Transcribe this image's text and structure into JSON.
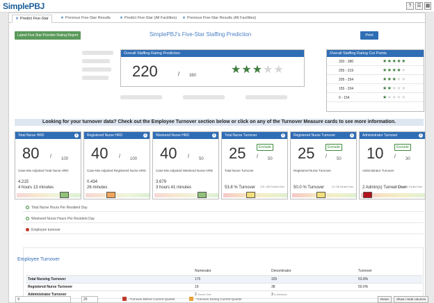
{
  "app": {
    "logo_main": "Simple",
    "logo_pbj": "PBJ",
    "help_icon": "?"
  },
  "tabs": [
    {
      "label": "Predict Five-Star",
      "active": true
    },
    {
      "label": "Previous Five-Star Results",
      "active": false
    },
    {
      "label": "Predict Five-Star (All Facilities)",
      "active": false
    },
    {
      "label": "Previous Five-Star Results (All Facilities)",
      "active": false
    }
  ],
  "toolbar": {
    "latest_report_label": "Latest Five Star Provider Rating Report",
    "page_title": "SimplePBJ's Five-Star Staffing Prediction",
    "print_label": "Print"
  },
  "overall": {
    "title": "Overall Staffing Rating Prediction",
    "score": "220",
    "slash": "/",
    "max": "380",
    "stars": 3,
    "star_total": 5
  },
  "cut_points": {
    "title": "Overall Staffing Rating Cut Points",
    "rows": [
      {
        "range": "320 - 380",
        "stars": 5
      },
      {
        "range": "255 - 319",
        "stars": 4
      },
      {
        "range": "205 - 254",
        "stars": 3
      },
      {
        "range": "155 - 204",
        "stars": 2
      },
      {
        "range": "0 - 154",
        "stars": 1
      }
    ]
  },
  "banner": "Looking for your turnover data? Check out the Employee Turnover section below or click on any of the Turnover Measure cards to see more information.",
  "cards": [
    {
      "title": "Total Nurse HRD",
      "value": "80",
      "slash": "/",
      "max": "100",
      "exclude": "",
      "sub": "Case-Mix Adjusted Total Nurse HRD",
      "line1": "4.215",
      "line2": "4 hours 13 minutes",
      "small": "",
      "marker": 0.78,
      "marker_color": "#8fc17a",
      "bar": "hrd"
    },
    {
      "title": "Registered Nurse HRD",
      "value": "40",
      "slash": "/",
      "max": "100",
      "exclude": "",
      "sub": "Case-Mix Adjusted Registered Nurse HRD",
      "line1": "0.434",
      "line2": "26 minutes",
      "small": "",
      "marker": 0.38,
      "marker_color": "#f0a65a",
      "bar": "hrd"
    },
    {
      "title": "Weekend Nurse HRD",
      "value": "40",
      "slash": "/",
      "max": "50",
      "exclude": "",
      "sub": "Case-Mix Adjusted Weekend Nurse HRD",
      "line1": "3.679",
      "line2": "3 hours 41 minutes",
      "small": "",
      "marker": 0.78,
      "marker_color": "#8fc17a",
      "bar": "hrd"
    },
    {
      "title": "Total Nurse Turnover",
      "value": "25",
      "slash": "/",
      "max": "50",
      "exclude": "Exclude",
      "sub": "Total Nurse Turnover",
      "line1": "",
      "line2": "53.8 % Turnover",
      "small": "175 / 325 Turned Over",
      "marker": 0.42,
      "marker_color": "#f2df7a",
      "bar": "turn"
    },
    {
      "title": "Registered Nurse Turnover",
      "value": "25",
      "slash": "/",
      "max": "50",
      "exclude": "Exclude",
      "sub": "Registered Nurse Turnover",
      "line1": "",
      "line2": "50.0 % Turnover",
      "small": "19 / 38 Turned Over",
      "marker": 0.44,
      "marker_color": "#f2df7a",
      "bar": "turn"
    },
    {
      "title": "Administrator Turnover",
      "value": "10",
      "slash": "/",
      "max": "30",
      "exclude": "Exclude",
      "sub": "Administrator Turnover",
      "line1": "",
      "line2": "2 Admin(s) Turned Over",
      "small": "2 / 3 Admins Turned Over",
      "marker": 0.04,
      "marker_color": "#b5121b",
      "bar": "turn"
    }
  ],
  "sections": [
    {
      "label": "Total Nurse Hours Per Resident Day",
      "state": "green"
    },
    {
      "label": "Weekend Nurse Hours Per Resident Day",
      "state": "green"
    },
    {
      "label": "Employee turnover",
      "state": "red"
    }
  ],
  "employee_turnover": {
    "title": "Employee Turnover",
    "headers": [
      "",
      "Numerator",
      "Denominator",
      "Turnover"
    ],
    "rows": [
      {
        "name": "Total Nursing Turnover",
        "numerator": "175",
        "num_note": "",
        "denominator": "325",
        "den_note": "",
        "turnover": "53.8%"
      },
      {
        "name": "Registered Nurse Turnover",
        "numerator": "19",
        "num_note": "",
        "denominator": "38",
        "den_note": "",
        "turnover": "50.0%"
      },
      {
        "name": "Administrator Turnover",
        "numerator": "2",
        "num_note": "Turned Over",
        "denominator": "3",
        "den_note": "In Abstracts",
        "turnover": ""
      }
    ]
  },
  "bottom": {
    "select_value": "25",
    "legend1": "- Turnover Before Current Quarter",
    "legend2": "- Turnover During Current Quarter",
    "legend1_color": "#c0392b",
    "legend2_color": "#e8a23a",
    "btn1": "Reset",
    "btn2": "Show / Hide columns"
  }
}
